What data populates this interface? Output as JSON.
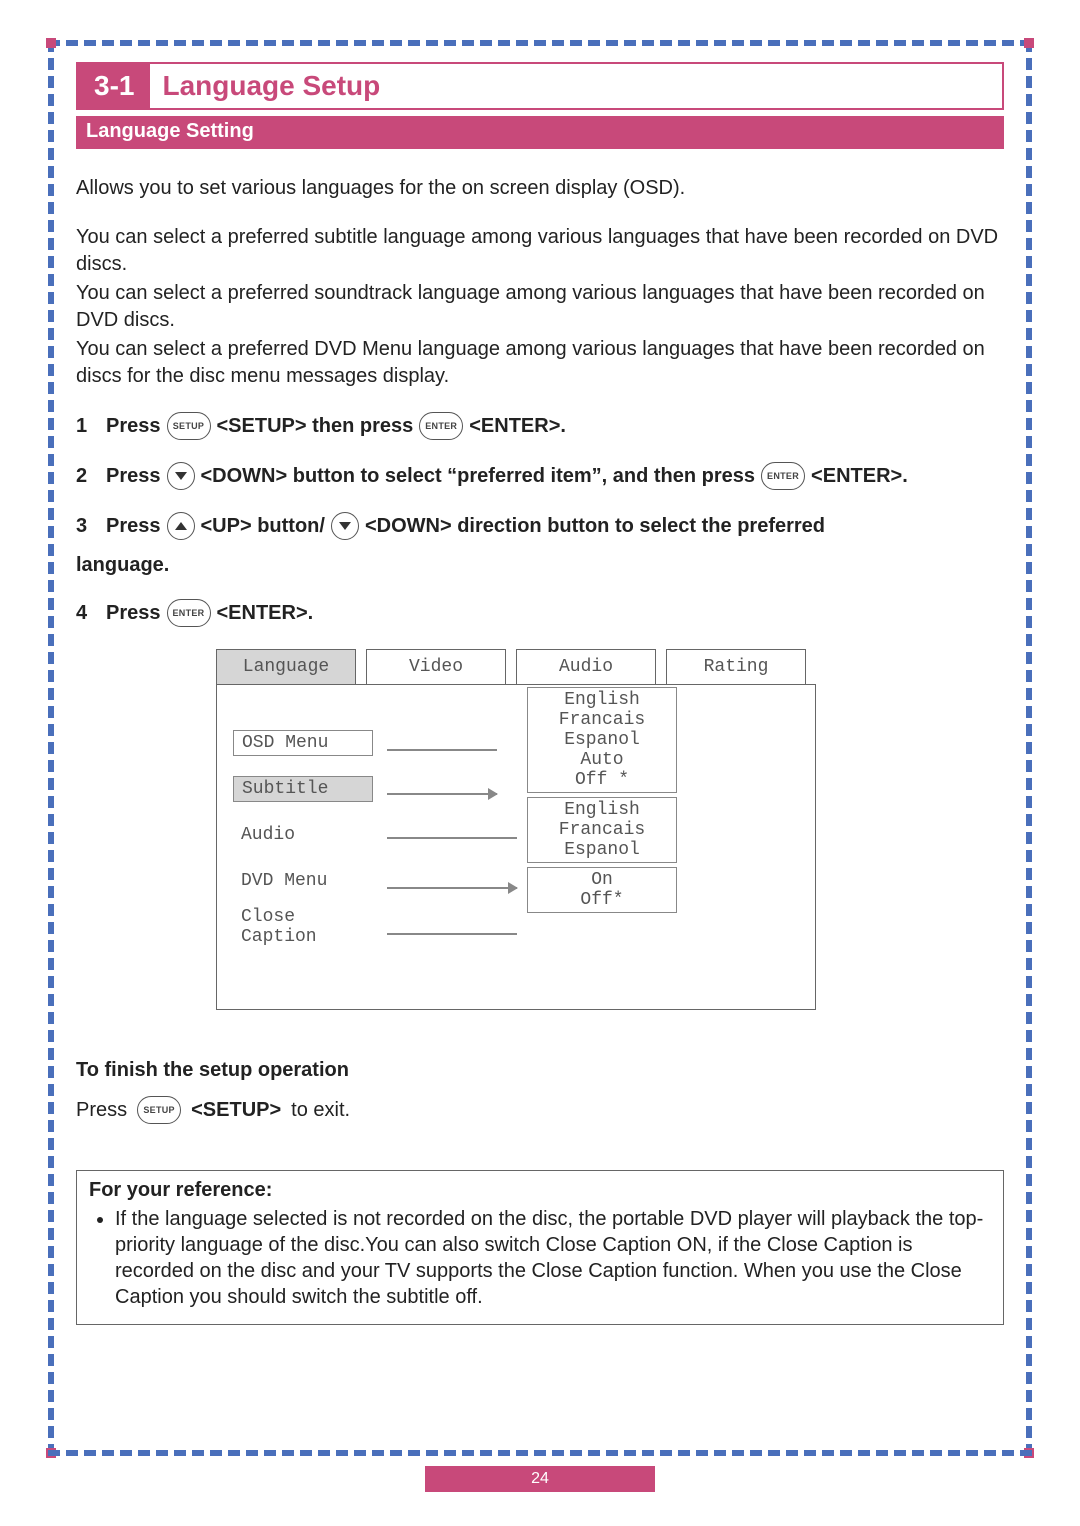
{
  "header": {
    "section_number": "3-1",
    "section_title": "Language Setup",
    "subsection": "Language Setting"
  },
  "intro": {
    "p1": "Allows you to set various languages for the on screen display (OSD).",
    "p2": "You can select a preferred subtitle language among various languages that have been recorded on DVD discs.",
    "p3": "You can select a preferred soundtrack language among various languages that have been recorded on DVD discs.",
    "p4": "You can select a preferred DVD Menu language among various languages that have been recorded on discs for the disc menu messages display."
  },
  "steps": {
    "s1": {
      "num": "1",
      "a": "Press",
      "btn1": "SETUP",
      "b": "<SETUP> then press",
      "btn2": "ENTER",
      "c": "<ENTER>."
    },
    "s2": {
      "num": "2",
      "a": "Press",
      "b": "<DOWN> button to select “preferred item”, and then press",
      "btn2": "ENTER",
      "c": "<ENTER>."
    },
    "s3": {
      "num": "3",
      "a": "Press",
      "b": "<UP> button/",
      "c": "<DOWN> direction button to select the preferred",
      "trail": "language."
    },
    "s4": {
      "num": "4",
      "a": "Press",
      "btn1": "ENTER",
      "b": "<ENTER>."
    }
  },
  "osd": {
    "tabs": [
      "Language",
      "Video",
      "Audio",
      "Rating"
    ],
    "left_items": [
      "OSD Menu",
      "Subtitle",
      "Audio",
      "DVD Menu",
      "Close Caption"
    ],
    "group_osd": [
      "English",
      "Francais",
      "Espanol",
      "Auto",
      "Off *"
    ],
    "group_audio": [
      "English",
      "Francais",
      "Espanol"
    ],
    "group_cc": [
      "On",
      "Off*"
    ]
  },
  "finish": {
    "heading": "To finish the setup operation",
    "line_a": "Press",
    "btn": "SETUP",
    "line_b": "<SETUP>",
    "line_c": "to exit."
  },
  "reference": {
    "title": "For your reference:",
    "bullet": "If the language selected is not recorded on the disc, the portable DVD player will playback the top-priority language of the disc.You can also switch Close Caption ON, if the Close Caption is recorded on the disc and your TV supports the Close Caption function. When you use the Close Caption you should switch the subtitle off."
  },
  "page_number": "24"
}
